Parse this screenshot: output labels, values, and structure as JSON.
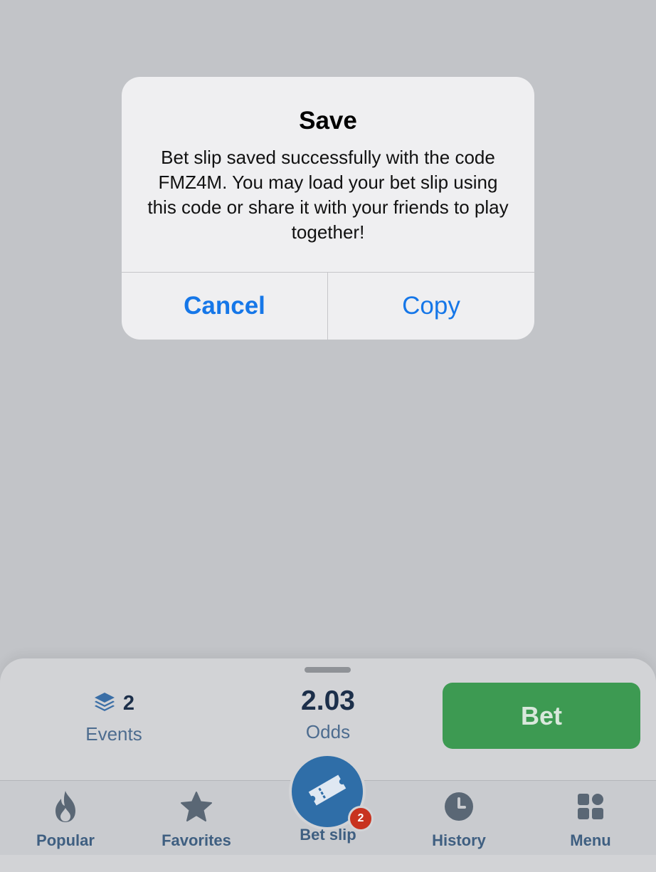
{
  "alert": {
    "title": "Save",
    "message": "Bet slip saved successfully with the code FMZ4M. You may load your bet slip using this code or share it with your friends to play together!",
    "cancel_label": "Cancel",
    "copy_label": "Copy"
  },
  "slip": {
    "events_count": "2",
    "events_label": "Events",
    "odds_value": "2.03",
    "odds_label": "Odds",
    "bet_label": "Bet"
  },
  "tabs": {
    "popular": "Popular",
    "favorites": "Favorites",
    "betslip": "Bet slip",
    "betslip_badge": "2",
    "history": "History",
    "menu": "Menu"
  },
  "colors": {
    "backdrop": "#c2c4c8",
    "alert_background": "#efeff1",
    "alert_button": "#1677e8",
    "bet_button": "#3d9a52",
    "tab_label": "#3f5f81",
    "betslip_circle": "#2f6ea8",
    "badge": "#c8321f"
  },
  "icons": {
    "events": "layers-icon",
    "popular": "flame-icon",
    "favorites": "star-icon",
    "betslip": "ticket-icon",
    "history": "clock-icon",
    "menu": "grid-icon"
  }
}
